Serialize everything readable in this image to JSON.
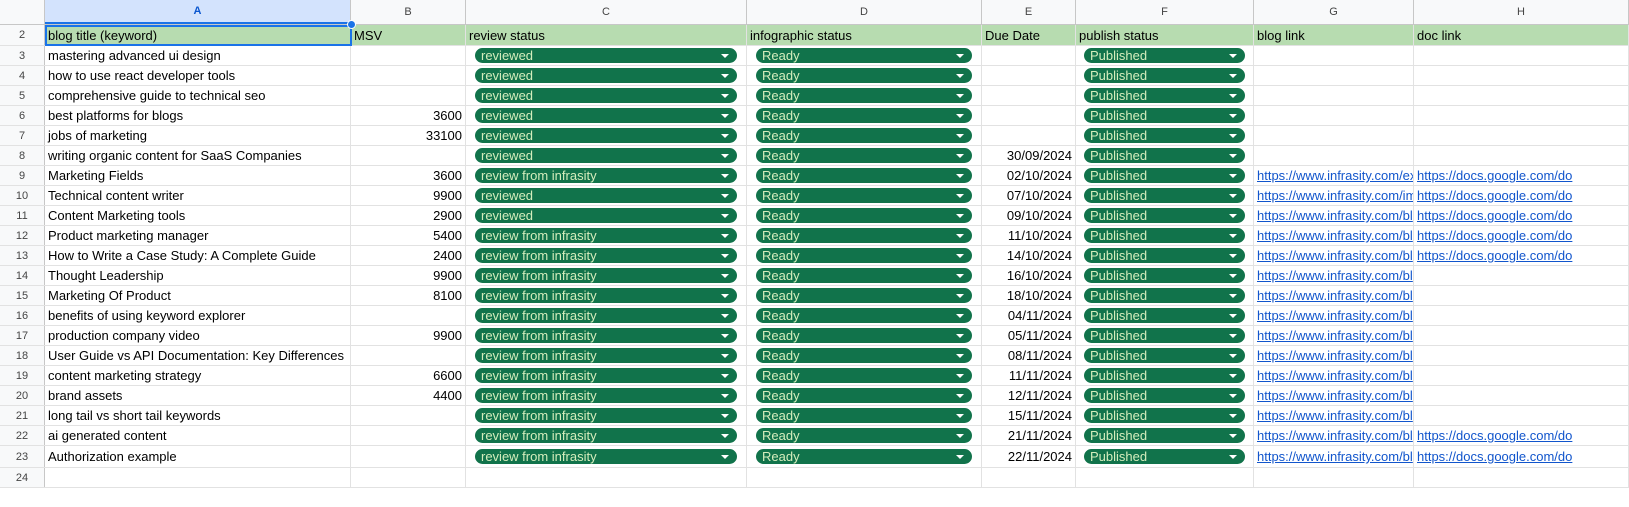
{
  "columns": [
    "A",
    "B",
    "C",
    "D",
    "E",
    "F",
    "G",
    "H"
  ],
  "header": {
    "row_number": "2",
    "cells": [
      "blog title (keyword)",
      "MSV",
      "review status",
      "infographic status",
      "Due Date",
      "publish status",
      "blog link",
      "doc link"
    ]
  },
  "rows": [
    {
      "n": "3",
      "title": "mastering advanced ui design",
      "msv": "",
      "review": "reviewed",
      "info": "Ready",
      "due": "",
      "publish": "Published",
      "blog": "",
      "doc": ""
    },
    {
      "n": "4",
      "title": "how to use react developer tools",
      "msv": "",
      "review": "reviewed",
      "info": "Ready",
      "due": "",
      "publish": "Published",
      "blog": "",
      "doc": ""
    },
    {
      "n": "5",
      "title": "comprehensive guide to technical seo",
      "msv": "",
      "review": "reviewed",
      "info": "Ready",
      "due": "",
      "publish": "Published",
      "blog": "",
      "doc": ""
    },
    {
      "n": "6",
      "title": "best platforms for blogs",
      "msv": "3600",
      "review": "reviewed",
      "info": "Ready",
      "due": "",
      "publish": "Published",
      "blog": "",
      "doc": ""
    },
    {
      "n": "7",
      "title": "jobs of marketing",
      "msv": "33100",
      "review": "reviewed",
      "info": "Ready",
      "due": "",
      "publish": "Published",
      "blog": "",
      "doc": ""
    },
    {
      "n": "8",
      "title": "writing organic content for SaaS Companies",
      "msv": "",
      "review": "reviewed",
      "info": "Ready",
      "due": "30/09/2024",
      "publish": "Published",
      "blog": "",
      "doc": ""
    },
    {
      "n": "9",
      "title": "Marketing Fields",
      "msv": "3600",
      "review": "review from infrasity",
      "info": "Ready",
      "due": "02/10/2024",
      "publish": "Published",
      "blog": "https://www.infrasity.com/ex",
      "doc": "https://docs.google.com/do"
    },
    {
      "n": "10",
      "title": "Technical content writer",
      "msv": "9900",
      "review": "reviewed",
      "info": "Ready",
      "due": "07/10/2024",
      "publish": "Published",
      "blog": "https://www.infrasity.com/im",
      "doc": "https://docs.google.com/do"
    },
    {
      "n": "11",
      "title": "Content Marketing tools",
      "msv": "2900",
      "review": "reviewed",
      "info": "Ready",
      "due": "09/10/2024",
      "publish": "Published",
      "blog": "https://www.infrasity.com/bl",
      "doc": "https://docs.google.com/do"
    },
    {
      "n": "12",
      "title": "Product marketing manager",
      "msv": "5400",
      "review": "review from infrasity",
      "info": "Ready",
      "due": "11/10/2024",
      "publish": "Published",
      "blog": "https://www.infrasity.com/bl",
      "doc": "https://docs.google.com/do"
    },
    {
      "n": "13",
      "title": "How to Write a Case Study: A Complete Guide",
      "msv": "2400",
      "review": "review from infrasity",
      "info": "Ready",
      "due": "14/10/2024",
      "publish": "Published",
      "blog": "https://www.infrasity.com/bl",
      "doc": "https://docs.google.com/do"
    },
    {
      "n": "14",
      "title": "Thought Leadership",
      "msv": "9900",
      "review": "review from infrasity",
      "info": "Ready",
      "due": "16/10/2024",
      "publish": "Published",
      "blog": "https://www.infrasity.com/bl",
      "doc": ""
    },
    {
      "n": "15",
      "title": "Marketing Of Product",
      "msv": "8100",
      "review": "review from infrasity",
      "info": "Ready",
      "due": "18/10/2024",
      "publish": "Published",
      "blog": "https://www.infrasity.com/bl",
      "doc": ""
    },
    {
      "n": "16",
      "title": "benefits of using keyword explorer",
      "msv": "",
      "review": "review from infrasity",
      "info": "Ready",
      "due": "04/11/2024",
      "publish": "Published",
      "blog": "https://www.infrasity.com/bl",
      "doc": ""
    },
    {
      "n": "17",
      "title": "production company video",
      "msv": "9900",
      "review": "review from infrasity",
      "info": "Ready",
      "due": "05/11/2024",
      "publish": "Published",
      "blog": "https://www.infrasity.com/bl",
      "doc": ""
    },
    {
      "n": "18",
      "title": "User Guide vs API Documentation: Key Differences",
      "msv": "",
      "review": "review from infrasity",
      "info": "Ready",
      "due": "08/11/2024",
      "publish": "Published",
      "blog": "https://www.infrasity.com/bl",
      "doc": ""
    },
    {
      "n": "19",
      "title": "content marketing strategy",
      "msv": "6600",
      "review": "review from infrasity",
      "info": "Ready",
      "due": "11/11/2024",
      "publish": "Published",
      "blog": "https://www.infrasity.com/bl",
      "doc": ""
    },
    {
      "n": "20",
      "title": "brand assets",
      "msv": "4400",
      "review": "review from infrasity",
      "info": "Ready",
      "due": "12/11/2024",
      "publish": "Published",
      "blog": "https://www.infrasity.com/bl",
      "doc": ""
    },
    {
      "n": "21",
      "title": "long tail vs short tail keywords",
      "msv": "",
      "review": "review from infrasity",
      "info": "Ready",
      "due": "15/11/2024",
      "publish": "Published",
      "blog": "https://www.infrasity.com/bl",
      "doc": ""
    },
    {
      "n": "22",
      "title": "ai generated content",
      "msv": "",
      "review": "review from infrasity",
      "info": "Ready",
      "due": "21/11/2024",
      "publish": "Published",
      "blog": "https://www.infrasity.com/bl",
      "doc": "https://docs.google.com/do"
    },
    {
      "n": "23",
      "title": "Authorization example",
      "msv": "",
      "review": "review from infrasity",
      "info": "Ready",
      "due": "22/11/2024",
      "publish": "Published",
      "blog": "https://www.infrasity.com/bl",
      "doc": "https://docs.google.com/do"
    }
  ],
  "last_row_number": "24",
  "colors": {
    "header_fill": "#b7dcb0",
    "chip_fill": "#11734b",
    "chip_text": "#d4edbc",
    "link": "#1155cc",
    "selection": "#1a73e8"
  }
}
